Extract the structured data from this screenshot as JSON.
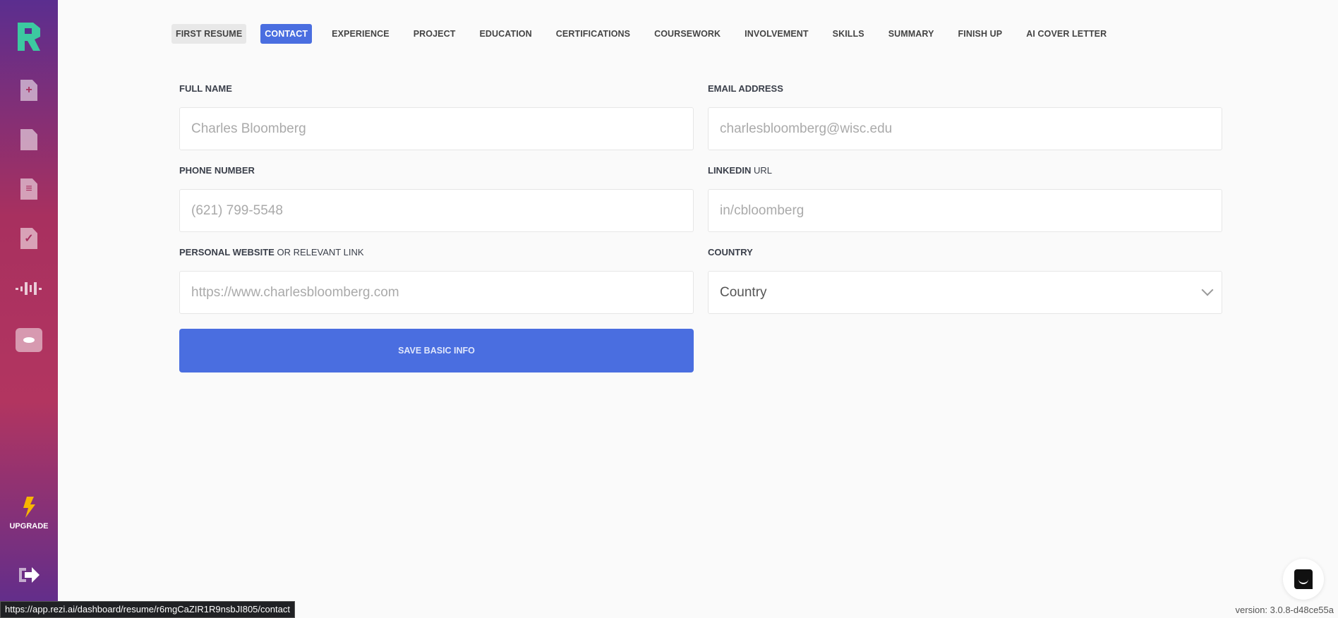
{
  "sidebar": {
    "upgrade_label": "UPGRADE"
  },
  "nav": {
    "tabs": [
      "FIRST RESUME",
      "CONTACT",
      "EXPERIENCE",
      "PROJECT",
      "EDUCATION",
      "CERTIFICATIONS",
      "COURSEWORK",
      "INVOLVEMENT",
      "SKILLS",
      "SUMMARY",
      "FINISH UP",
      "AI COVER LETTER"
    ],
    "active": "CONTACT"
  },
  "form": {
    "full_name": {
      "label": "FULL NAME",
      "placeholder": "Charles Bloomberg"
    },
    "email": {
      "label": "EMAIL ADDRESS",
      "placeholder": "charlesbloomberg@wisc.edu"
    },
    "phone": {
      "label": "PHONE NUMBER",
      "placeholder": "(621) 799-5548"
    },
    "linkedin": {
      "label_bold": "LINKEDIN",
      "label_rest": " URL",
      "placeholder": "in/cbloomberg"
    },
    "website": {
      "label_bold": "PERSONAL WEBSITE",
      "label_rest": " OR RELEVANT LINK",
      "placeholder": "https://www.charlesbloomberg.com"
    },
    "country": {
      "label": "COUNTRY",
      "value": "Country"
    },
    "save_label": "SAVE BASIC INFO"
  },
  "status_url": "https://app.rezi.ai/dashboard/resume/r6mgCaZIR1R9nsbJI805/contact",
  "version": "version: 3.0.8-d48ce55a",
  "colors": {
    "accent": "#4a6ee0",
    "logo": "#3cc9a0"
  }
}
